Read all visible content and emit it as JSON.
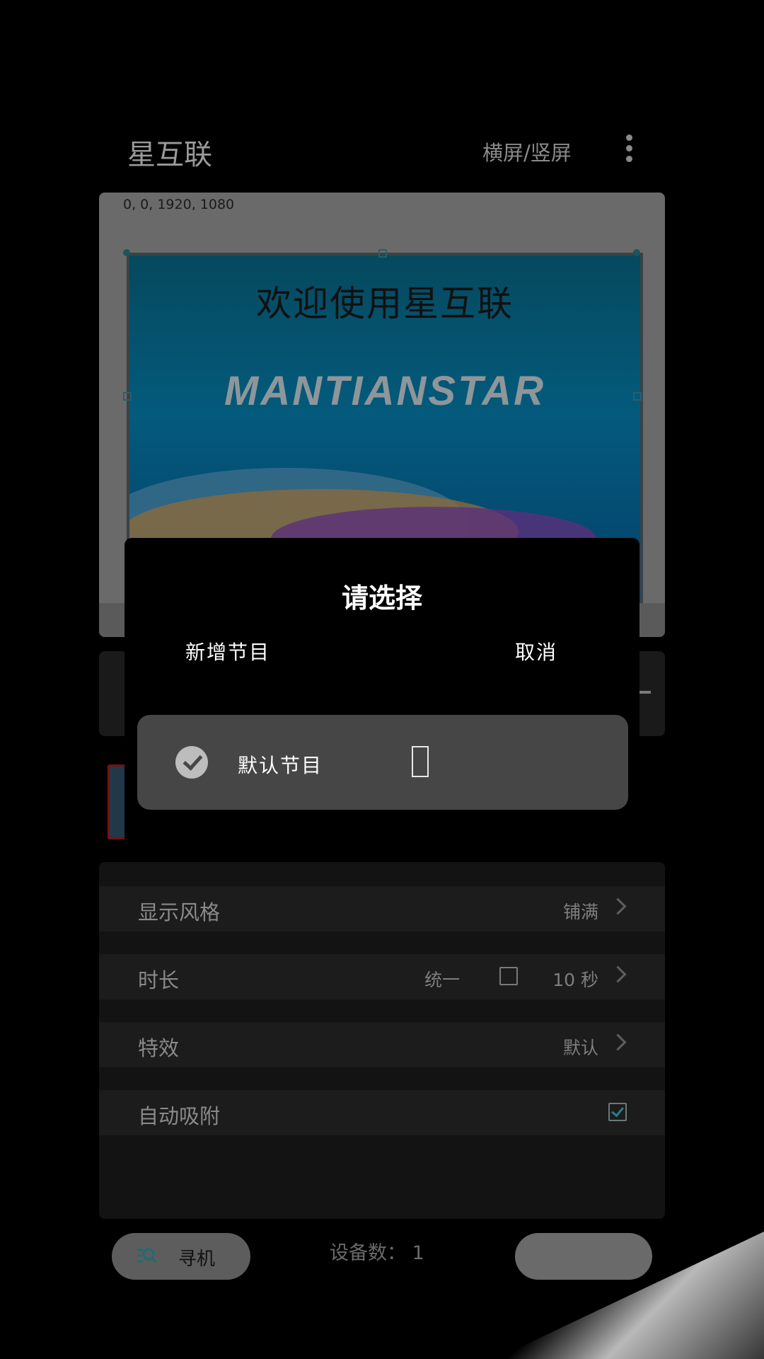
{
  "app": {
    "title": "星互联",
    "orientation_toggle": "横屏/竖屏",
    "more_icon": "more-vertical-icon"
  },
  "preview": {
    "coords": "0, 0, 1920, 1080",
    "heading": "欢迎使用星互联",
    "logo_text": "MANTIANSTAR"
  },
  "dialog": {
    "title": "请选择",
    "add_label": "新增节目",
    "cancel_label": "取消",
    "programs": [
      {
        "name": "默认节目",
        "selected": true,
        "glyph": ""
      }
    ]
  },
  "settings": {
    "display_style": {
      "label": "显示风格",
      "value": "铺满"
    },
    "duration": {
      "label": "时长",
      "unify_label": "统一",
      "unify_checked": false,
      "value": "10 秒"
    },
    "effect": {
      "label": "特效",
      "value": "默认"
    },
    "auto_snap": {
      "label": "自动吸附",
      "checked": true
    }
  },
  "bottom": {
    "search_label": "寻机",
    "search_icon": "search-list-icon",
    "device_count": "设备数： 1"
  },
  "colors": {
    "dialog_bg": "#000000",
    "item_bg": "#464646",
    "accent": "#2c7c86"
  }
}
